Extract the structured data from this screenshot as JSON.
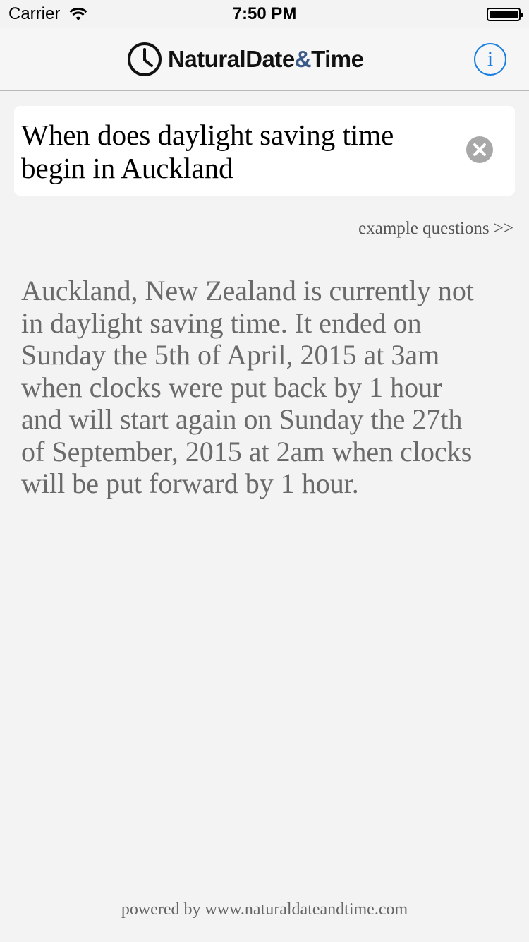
{
  "status_bar": {
    "carrier": "Carrier",
    "time": "7:50 PM",
    "wifi_icon": "wifi-icon",
    "battery_icon": "battery-icon"
  },
  "nav": {
    "logo_part1": "NaturalDate",
    "logo_amp": "&",
    "logo_part2": "Time",
    "logo_icon": "clock-icon",
    "info_label": "i",
    "accent_color": "#1a7ee3"
  },
  "search": {
    "query": "When does daylight saving time begin in Auckland",
    "clear_icon": "clear-icon"
  },
  "example_link": "example questions >>",
  "answer": "Auckland, New Zealand is currently not in daylight saving time. It ended on Sunday the 5th of April, 2015 at 3am when clocks were put back by 1 hour and will start again on Sunday the 27th of September, 2015 at 2am when clocks will be put forward by 1 hour.",
  "footer": "powered by www.naturaldateandtime.com"
}
